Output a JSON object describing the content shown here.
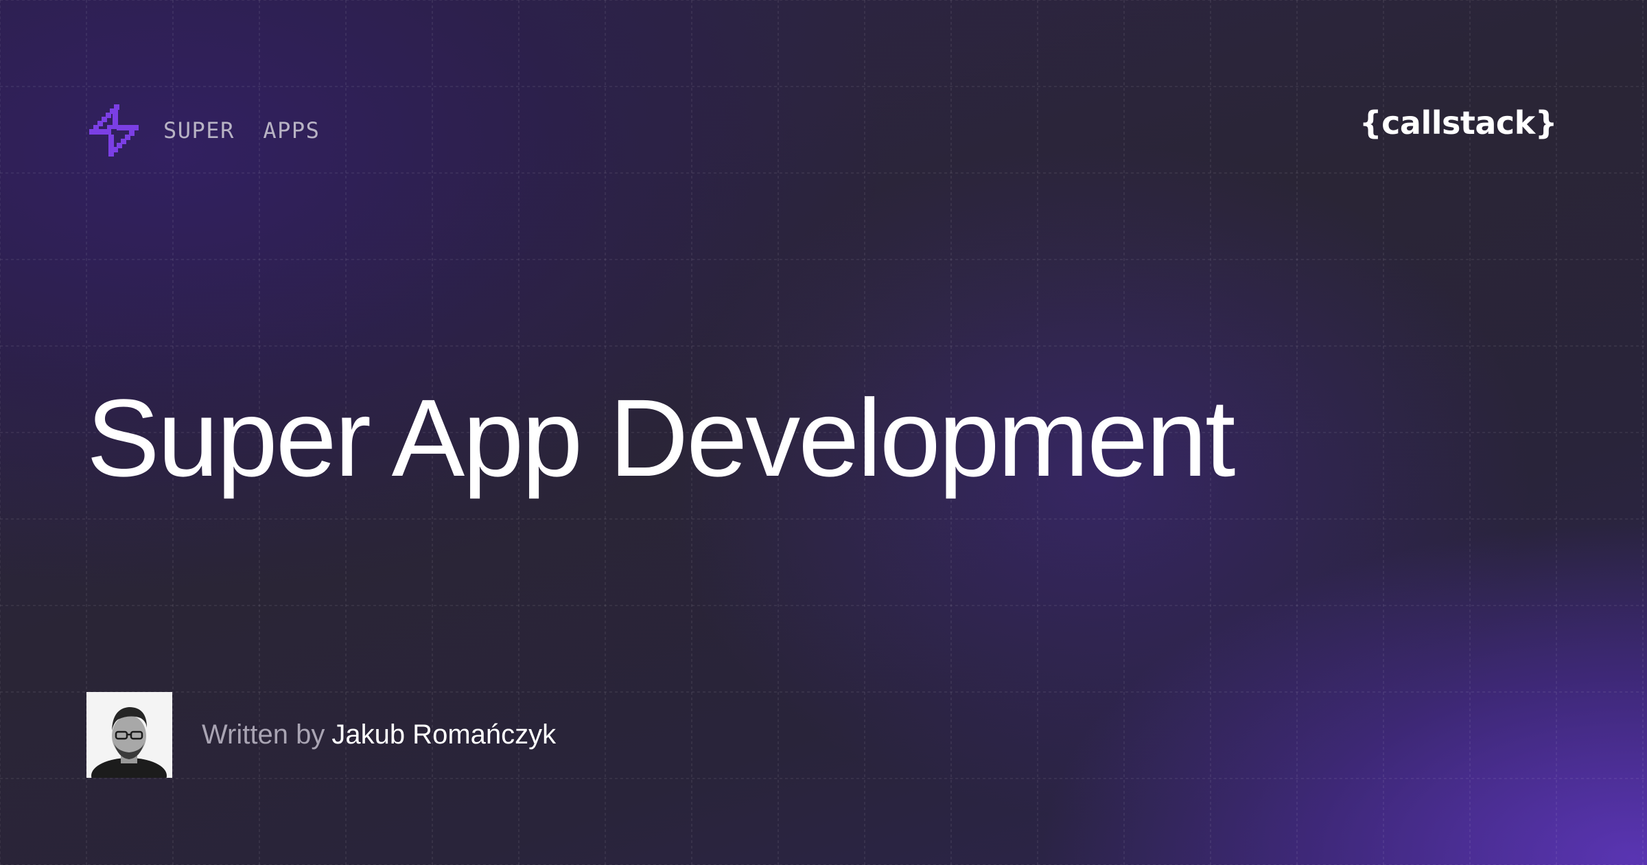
{
  "header": {
    "brand_label": "SUPER  APPS",
    "company_logo": "{callstack}"
  },
  "hero": {
    "title": "Super App Development"
  },
  "author": {
    "prefix": "Written by",
    "name": "Jakub Romańczyk"
  },
  "icons": {
    "brand": "lightning-bolt-icon",
    "avatar": "author-avatar"
  },
  "colors": {
    "background": "#27232b",
    "accent": "#7b3fe4",
    "text_primary": "#ffffff",
    "text_muted": "#b8b3c4"
  }
}
